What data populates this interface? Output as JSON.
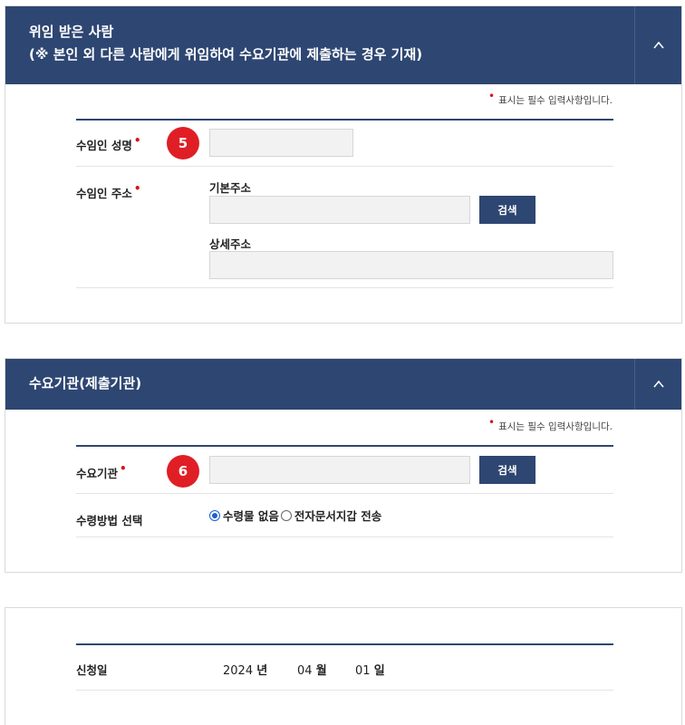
{
  "section1": {
    "title_line1": "위임 받은 사람",
    "title_line2": "(※ 본인 외 다른 사람에게 위임하여 수요기관에 제출하는 경우 기재)",
    "required_note": "표시는 필수 입력사항입니다.",
    "name_label": "수임인 성명",
    "name_badge": "5",
    "name_value": "",
    "address_label": "수임인 주소",
    "basic_address_label": "기본주소",
    "basic_address_value": "",
    "search_label": "검색",
    "detail_address_label": "상세주소",
    "detail_address_value": ""
  },
  "section2": {
    "title": "수요기관(제출기관)",
    "required_note": "표시는 필수 입력사항입니다.",
    "agency_label": "수요기관",
    "agency_badge": "6",
    "agency_value": "",
    "search_label": "검색",
    "method_label": "수령방법 선택",
    "options": [
      "수령물 없음",
      "전자문서지갑 전송"
    ],
    "selected_option": "수령물 없음"
  },
  "section3": {
    "date_label": "신청일",
    "year": "2024",
    "year_unit": "년",
    "month": "04",
    "month_unit": "월",
    "day": "01",
    "day_unit": "일"
  },
  "colors": {
    "header": "#2e4672",
    "badge": "#e01e25",
    "required_dot": "#d7141c",
    "radio_selected": "#1a5fd6"
  },
  "icons": {
    "collapse": "chevron-up-icon"
  }
}
